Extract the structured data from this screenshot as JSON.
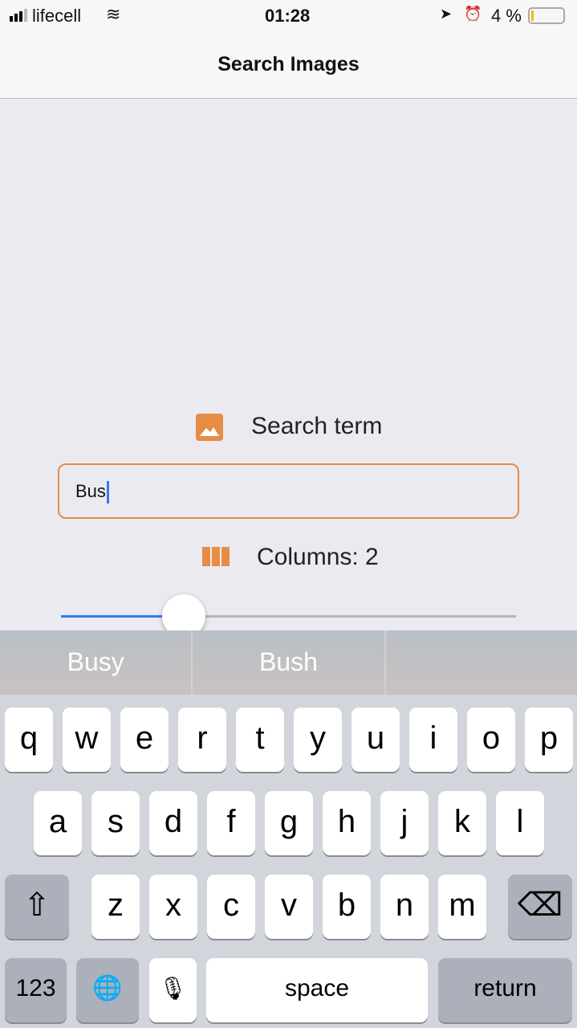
{
  "status": {
    "carrier": "lifecell",
    "time": "01:28",
    "battery": "4 %"
  },
  "nav": {
    "title": "Search Images"
  },
  "form": {
    "search_label": "Search term",
    "search_value": "Bus",
    "columns_label": "Columns: 2",
    "slider_value_fraction": 0.27
  },
  "suggestions": [
    "Busy",
    "Bush",
    ""
  ],
  "keyboard": {
    "row1": [
      "q",
      "w",
      "e",
      "r",
      "t",
      "y",
      "u",
      "i",
      "o",
      "p"
    ],
    "row2": [
      "a",
      "s",
      "d",
      "f",
      "g",
      "h",
      "j",
      "k",
      "l"
    ],
    "row3": [
      "z",
      "x",
      "c",
      "v",
      "b",
      "n",
      "m"
    ],
    "numbers": "123",
    "space": "space",
    "return": "return"
  },
  "colors": {
    "accent": "#e58d44",
    "slider": "#3478f6"
  }
}
